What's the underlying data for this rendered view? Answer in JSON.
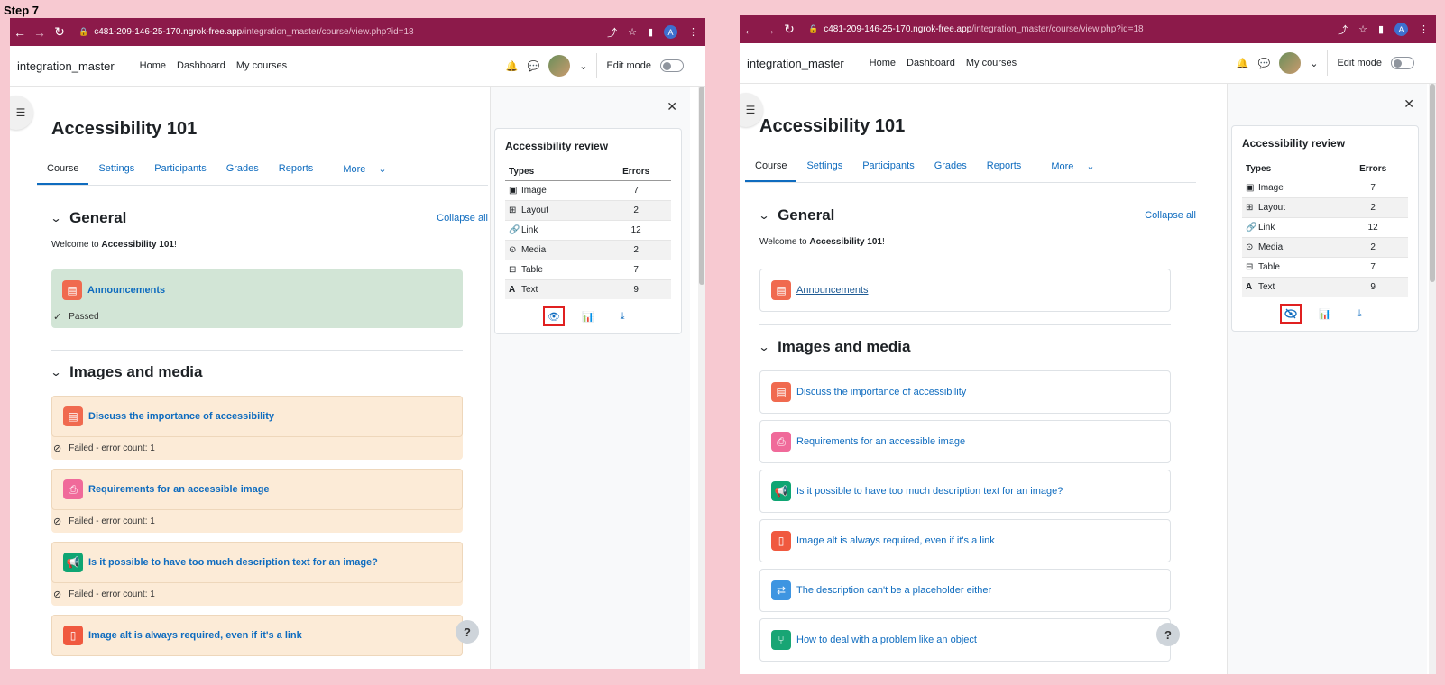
{
  "step_label": "Step 7",
  "browser": {
    "url_host": "c481-209-146-25-170.ngrok-free.app",
    "url_path": "/integration_master/course/view.php?id=18",
    "profile_initial": "A"
  },
  "header": {
    "site_name": "integration_master",
    "nav": [
      "Home",
      "Dashboard",
      "My courses"
    ],
    "edit_mode_label": "Edit mode"
  },
  "course": {
    "title": "Accessibility 101",
    "tabs": [
      "Course",
      "Settings",
      "Participants",
      "Grades",
      "Reports",
      "More"
    ],
    "collapse_all": "Collapse all",
    "welcome_prefix": "Welcome to ",
    "welcome_course": "Accessibility 101",
    "welcome_suffix": "!"
  },
  "sections": {
    "general": "General",
    "images_media": "Images and media"
  },
  "activities": {
    "announcements": "Announcements",
    "a1": "Discuss the importance of accessibility",
    "a2": "Requirements for an accessible image",
    "a3": "Is it possible to have too much description text for an image?",
    "a4": "Image alt is always required, even if it's a link",
    "a5": "The description can't be a placeholder either",
    "a6": "How to deal with a problem like an object"
  },
  "status": {
    "passed": "Passed",
    "failed": "Failed - error count: 1"
  },
  "review": {
    "title": "Accessibility review",
    "col_types": "Types",
    "col_errors": "Errors",
    "rows": [
      {
        "type": "Image",
        "errors": "7"
      },
      {
        "type": "Layout",
        "errors": "2"
      },
      {
        "type": "Link",
        "errors": "12"
      },
      {
        "type": "Media",
        "errors": "2"
      },
      {
        "type": "Table",
        "errors": "7"
      },
      {
        "type": "Text",
        "errors": "9"
      }
    ]
  },
  "help": "?",
  "colors": {
    "chrome": "#8c1a4a",
    "link": "#0f6cbf",
    "passed_bg": "#d2e5d6",
    "failed_bg": "#fcebd7",
    "highlight": "#e02020"
  }
}
